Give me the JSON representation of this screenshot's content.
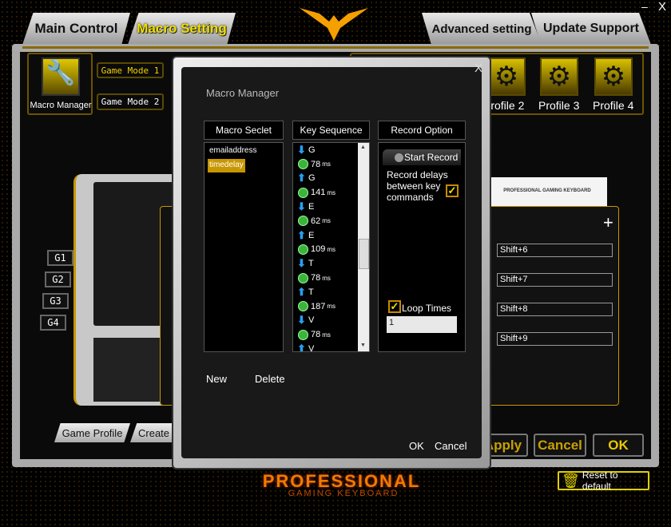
{
  "window": {
    "minimize": "–",
    "close": "X"
  },
  "tabs": {
    "main_control": "Main Control",
    "macro_setting": "Macro Setting",
    "advanced": "Advanced setting",
    "update": "Update Support"
  },
  "toolbar": {
    "macro_manager": "Macro Manager",
    "game_mode_1": "Game Mode 1",
    "game_mode_2": "Game Mode 2",
    "profiles": [
      "Profile 2",
      "Profile 3",
      "Profile 4"
    ]
  },
  "g_keys": [
    "G1",
    "G2",
    "G3",
    "G4"
  ],
  "keyboard_brand": "PROFESSIONAL GAMING KEYBOARD",
  "assignments": {
    "add": "+",
    "items": [
      "Shift+6",
      "Shift+7",
      "Shift+8",
      "Shift+9"
    ]
  },
  "bottom_tabs": {
    "game_profile": "Game Profile",
    "create": "Create"
  },
  "buttons": {
    "apply": "Apply",
    "cancel": "Cancel",
    "ok": "OK",
    "reset": "Reset to default"
  },
  "logo": {
    "line1": "PROFESSIONAL",
    "line2": "GAMING KEYBOARD"
  },
  "modal": {
    "title": "Macro Manager",
    "close": "X",
    "headers": {
      "select": "Macro Seclet",
      "sequence": "Key Sequence",
      "record": "Record Option"
    },
    "macros": [
      {
        "name": "emailaddress",
        "selected": false
      },
      {
        "name": "timedelay",
        "selected": true
      }
    ],
    "sequence": [
      {
        "type": "down",
        "key": "G"
      },
      {
        "type": "delay",
        "value": "78",
        "unit": "ms"
      },
      {
        "type": "up",
        "key": "G"
      },
      {
        "type": "delay",
        "value": "141",
        "unit": "ms"
      },
      {
        "type": "down",
        "key": "E"
      },
      {
        "type": "delay",
        "value": "62",
        "unit": "ms"
      },
      {
        "type": "up",
        "key": "E"
      },
      {
        "type": "delay",
        "value": "109",
        "unit": "ms"
      },
      {
        "type": "down",
        "key": "T"
      },
      {
        "type": "delay",
        "value": "78",
        "unit": "ms"
      },
      {
        "type": "up",
        "key": "T"
      },
      {
        "type": "delay",
        "value": "187",
        "unit": "ms"
      },
      {
        "type": "down",
        "key": "V"
      },
      {
        "type": "delay",
        "value": "78",
        "unit": "ms"
      },
      {
        "type": "up",
        "key": "V"
      }
    ],
    "start_record": "Start Record",
    "record_delays": "Record delays between key commands",
    "record_delays_checked": true,
    "loop_times_label": "Loop Times",
    "loop_times_checked": true,
    "loop_times_value": "1",
    "new": "New",
    "delete": "Delete",
    "ok": "OK",
    "cancel": "Cancel"
  },
  "colors": {
    "accent": "#f0d000",
    "orange": "#f07a00",
    "selected": "#c89600"
  }
}
